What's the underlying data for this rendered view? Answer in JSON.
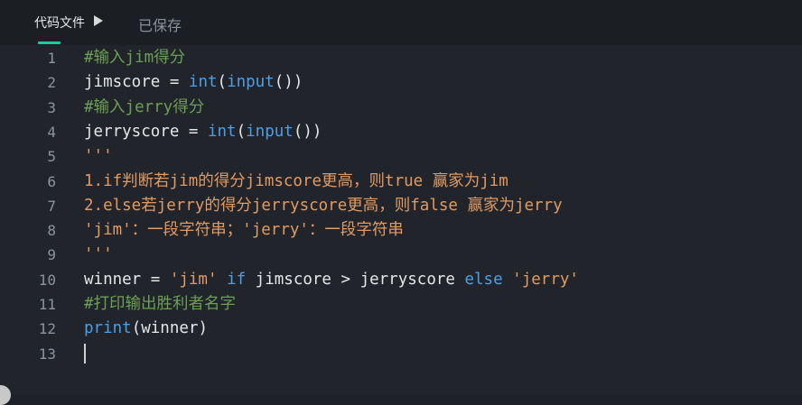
{
  "tab": {
    "file_label": "代码文件",
    "saved_label": "已保存"
  },
  "colors": {
    "accent": "#1fc9a1",
    "comment": "#6a9f54",
    "builtin": "#4e9ee6",
    "string": "#e09a63",
    "text": "#e6e6e6"
  },
  "editor": {
    "lines": [
      {
        "num": "1",
        "tokens": [
          {
            "t": "#输入jim得分",
            "k": "comment"
          }
        ]
      },
      {
        "num": "2",
        "tokens": [
          {
            "t": "jimscore = ",
            "k": "plain"
          },
          {
            "t": "int",
            "k": "builtin"
          },
          {
            "t": "(",
            "k": "plain"
          },
          {
            "t": "input",
            "k": "builtin"
          },
          {
            "t": "())",
            "k": "plain"
          }
        ]
      },
      {
        "num": "3",
        "tokens": [
          {
            "t": "#输入jerry得分",
            "k": "comment"
          }
        ]
      },
      {
        "num": "4",
        "tokens": [
          {
            "t": "jerryscore = ",
            "k": "plain"
          },
          {
            "t": "int",
            "k": "builtin"
          },
          {
            "t": "(",
            "k": "plain"
          },
          {
            "t": "input",
            "k": "builtin"
          },
          {
            "t": "())",
            "k": "plain"
          }
        ]
      },
      {
        "num": "5",
        "tokens": [
          {
            "t": "'''",
            "k": "string"
          }
        ]
      },
      {
        "num": "6",
        "tokens": [
          {
            "t": "1.if判断若jim的得分jimscore更高，则true 赢家为jim",
            "k": "string"
          }
        ]
      },
      {
        "num": "7",
        "tokens": [
          {
            "t": "2.else若jerry的得分jerryscore更高，则false 赢家为jerry",
            "k": "string"
          }
        ]
      },
      {
        "num": "8",
        "tokens": [
          {
            "t": "'jim'：一段字符串；'jerry'：一段字符串",
            "k": "string"
          }
        ]
      },
      {
        "num": "9",
        "tokens": [
          {
            "t": "'''",
            "k": "string"
          }
        ]
      },
      {
        "num": "10",
        "tokens": [
          {
            "t": "winner = ",
            "k": "plain"
          },
          {
            "t": "'jim'",
            "k": "string"
          },
          {
            "t": " ",
            "k": "plain"
          },
          {
            "t": "if",
            "k": "builtin"
          },
          {
            "t": " jimscore > jerryscore ",
            "k": "plain"
          },
          {
            "t": "else",
            "k": "builtin"
          },
          {
            "t": " ",
            "k": "plain"
          },
          {
            "t": "'jerry'",
            "k": "string"
          }
        ]
      },
      {
        "num": "11",
        "tokens": [
          {
            "t": "#打印输出胜利者名字",
            "k": "comment"
          }
        ]
      },
      {
        "num": "12",
        "tokens": [
          {
            "t": "print",
            "k": "builtin"
          },
          {
            "t": "(winner)",
            "k": "plain"
          }
        ]
      },
      {
        "num": "13",
        "tokens": [],
        "cursor": true
      }
    ]
  }
}
